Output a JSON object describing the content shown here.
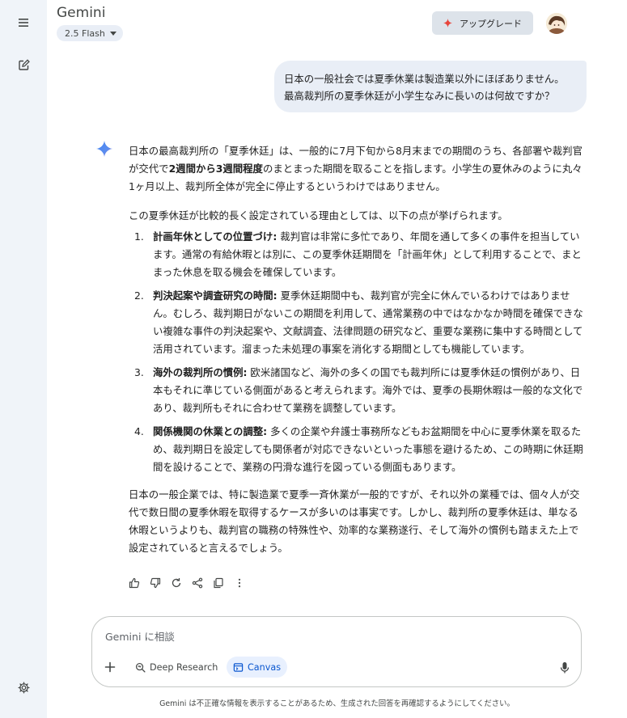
{
  "app": {
    "title": "Gemini",
    "model_label": "2.5 Flash",
    "upgrade_label": "アップグレード"
  },
  "sidebar": {
    "menu_icon": "hamburger-menu-icon",
    "new_chat_icon": "edit-icon",
    "settings_icon": "gear-icon"
  },
  "user_message": {
    "line1": "日本の一般社会では夏季休業は製造業以外にほぼありません。",
    "line2": "最高裁判所の夏季休廷が小学生なみに長いのは何故ですか？"
  },
  "response": {
    "p1_pre": "日本の最高裁判所の「夏季休廷」は、一般的に7月下旬から8月末までの期間のうち、各部署や裁判官が交代で",
    "p1_bold": "2週間から3週間程度",
    "p1_post": "のまとまった期間を取ることを指します。小学生の夏休みのように丸々1ヶ月以上、裁判所全体が完全に停止するというわけではありません。",
    "intro": "この夏季休廷が比較的長く設定されている理由としては、以下の点が挙げられます。",
    "items": [
      {
        "num": "1.",
        "title": "計画年休としての位置づけ:",
        "body": " 裁判官は非常に多忙であり、年間を通して多くの事件を担当しています。通常の有給休暇とは別に、この夏季休廷期間を「計画年休」として利用することで、まとまった休息を取る機会を確保しています。"
      },
      {
        "num": "2.",
        "title": "判決起案や調査研究の時間:",
        "body": " 夏季休廷期間中も、裁判官が完全に休んでいるわけではありません。むしろ、裁判期日がないこの期間を利用して、通常業務の中ではなかなか時間を確保できない複雑な事件の判決起案や、文献調査、法律問題の研究など、重要な業務に集中する時間として活用されています。溜まった未処理の事案を消化する期間としても機能しています。"
      },
      {
        "num": "3.",
        "title": "海外の裁判所の慣例:",
        "body": " 欧米諸国など、海外の多くの国でも裁判所には夏季休廷の慣例があり、日本もそれに準じている側面があると考えられます。海外では、夏季の長期休暇は一般的な文化であり、裁判所もそれに合わせて業務を調整しています。"
      },
      {
        "num": "4.",
        "title": "関係機関の休業との調整:",
        "body": " 多くの企業や弁護士事務所などもお盆期間を中心に夏季休業を取るため、裁判期日を設定しても関係者が対応できないといった事態を避けるため、この時期に休廷期間を設けることで、業務の円滑な進行を図っている側面もあります。"
      }
    ],
    "conclusion": "日本の一般企業では、特に製造業で夏季一斉休業が一般的ですが、それ以外の業種では、個々人が交代で数日間の夏季休暇を取得するケースが多いのは事実です。しかし、裁判所の夏季休廷は、単なる休暇というよりも、裁判官の職務の特殊性や、効率的な業務遂行、そして海外の慣例も踏まえた上で設定されていると言えるでしょう。"
  },
  "actions": [
    "thumbs-up-icon",
    "thumbs-down-icon",
    "refresh-icon",
    "share-icon",
    "copy-icon",
    "more-vert-icon"
  ],
  "composer": {
    "placeholder": "Gemini に相談",
    "deep_research_label": "Deep Research",
    "canvas_label": "Canvas"
  },
  "disclaimer": "Gemini は不正確な情報を表示することがあるため、生成された回答を再確認するようにしてください。",
  "colors": {
    "sidebar_bg": "#f0f4f9",
    "bubble_bg": "#e9eef6",
    "accent_blue": "#0b57d0",
    "upgrade_star": "#e8453c"
  }
}
